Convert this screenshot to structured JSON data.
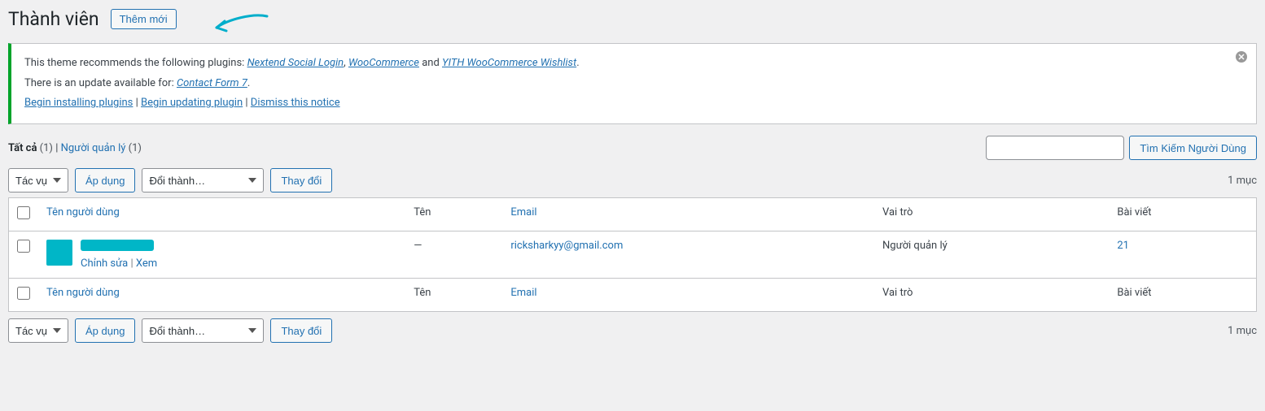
{
  "header": {
    "title": "Thành viên",
    "add_new": "Thêm mới"
  },
  "notice": {
    "line1_prefix": "This theme recommends the following plugins: ",
    "plugin1": "Nextend Social Login",
    "sep1": ", ",
    "plugin2": "WooCommerce",
    "sep2": " and ",
    "plugin3": "YITH WooCommerce Wishlist",
    "line1_suffix": ".",
    "line2_prefix": "There is an update available for: ",
    "plugin4": "Contact Form 7",
    "line2_suffix": ".",
    "action_install": "Begin installing plugins",
    "action_update": "Begin updating plugin",
    "action_dismiss": "Dismiss this notice",
    "sep_pipe": " | "
  },
  "filters": {
    "all_label": "Tất cả",
    "all_count": "(1)",
    "sep": " | ",
    "admin_label": "Người quản lý",
    "admin_count": "(1)"
  },
  "search": {
    "button": "Tìm Kiếm Người Dùng"
  },
  "bulk": {
    "action_placeholder": "Tác vụ",
    "apply": "Áp dụng",
    "role_placeholder": "Đổi thành…",
    "change": "Thay đổi"
  },
  "pagination": {
    "items": "1 mục"
  },
  "columns": {
    "username": "Tên người dùng",
    "name": "Tên",
    "email": "Email",
    "role": "Vai trò",
    "posts": "Bài viết"
  },
  "rows": [
    {
      "name": "—",
      "email": "ricksharkyy@gmail.com",
      "role": "Người quản lý",
      "posts": "21",
      "edit": "Chỉnh sửa",
      "view": "Xem"
    }
  ]
}
